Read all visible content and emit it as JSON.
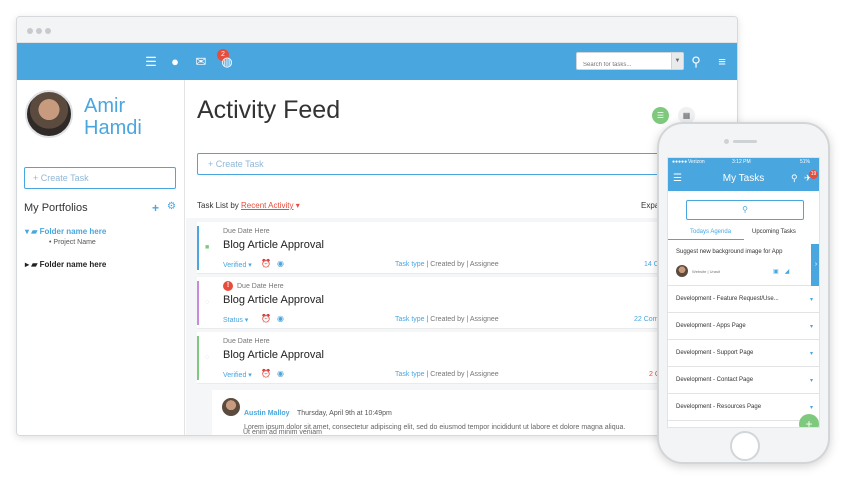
{
  "browser": {
    "search": {
      "placeholder": "Search for tasks..."
    },
    "notification_count": "2"
  },
  "sidebar": {
    "user_first": "Amir",
    "user_last": "Hamdi",
    "create_task": "+ Create Task",
    "portfolios_title": "My Portfolios",
    "folders": [
      {
        "label": "Folder name here",
        "project": "Project Name"
      },
      {
        "label": "Folder name here"
      }
    ]
  },
  "main": {
    "title": "Activity Feed",
    "create_task": "+ Create Task",
    "task_list_label": "Task List by",
    "sort_label": "Recent Activity",
    "expand_label": "Expa",
    "tasks": [
      {
        "due": "Due Date Here",
        "name": "Blog Article Approval",
        "status": "Verified",
        "type": "Task type",
        "meta": "| Created by | Assignee",
        "comments": "14 C",
        "stripe": "#4aa6df"
      },
      {
        "due": "Due Date Here",
        "name": "Blog Article Approval",
        "status": "Status",
        "type": "Task type",
        "meta": "| Created by | Assignee",
        "comments": "22 Com",
        "stripe": "#c78bdc"
      },
      {
        "due": "Due Date Here",
        "name": "Blog Article Approval",
        "status": "Verified",
        "type": "Task type",
        "meta": "| Created by | Assignee",
        "comments": "2 C",
        "stripe": "#7ec97e"
      }
    ],
    "comment": {
      "author": "Austin Malloy",
      "date": "Thursday, April 9th at 10:49pm",
      "text1": "Lorem ipsum dolor sit amet, consectetur adipiscing elit, sed do eiusmod tempor incididunt ut labore et dolore magna aliqua.",
      "text2": "Ut enim ad minim veniam"
    }
  },
  "phone": {
    "carrier": "Verizon",
    "time": "3:12 PM",
    "battery": "51%",
    "title": "My Tasks",
    "badge": "19",
    "tab_agenda": "Todays Agenda",
    "tab_upcoming": "Upcoming Tasks",
    "featured": {
      "text": "Suggest new background image for App",
      "meta": "Website | Urasit"
    },
    "rows": [
      "Development - Feature Request/Use...",
      "Development - Apps Page",
      "Development - Support Page",
      "Development - Contact Page",
      "Development - Resources Page"
    ]
  }
}
